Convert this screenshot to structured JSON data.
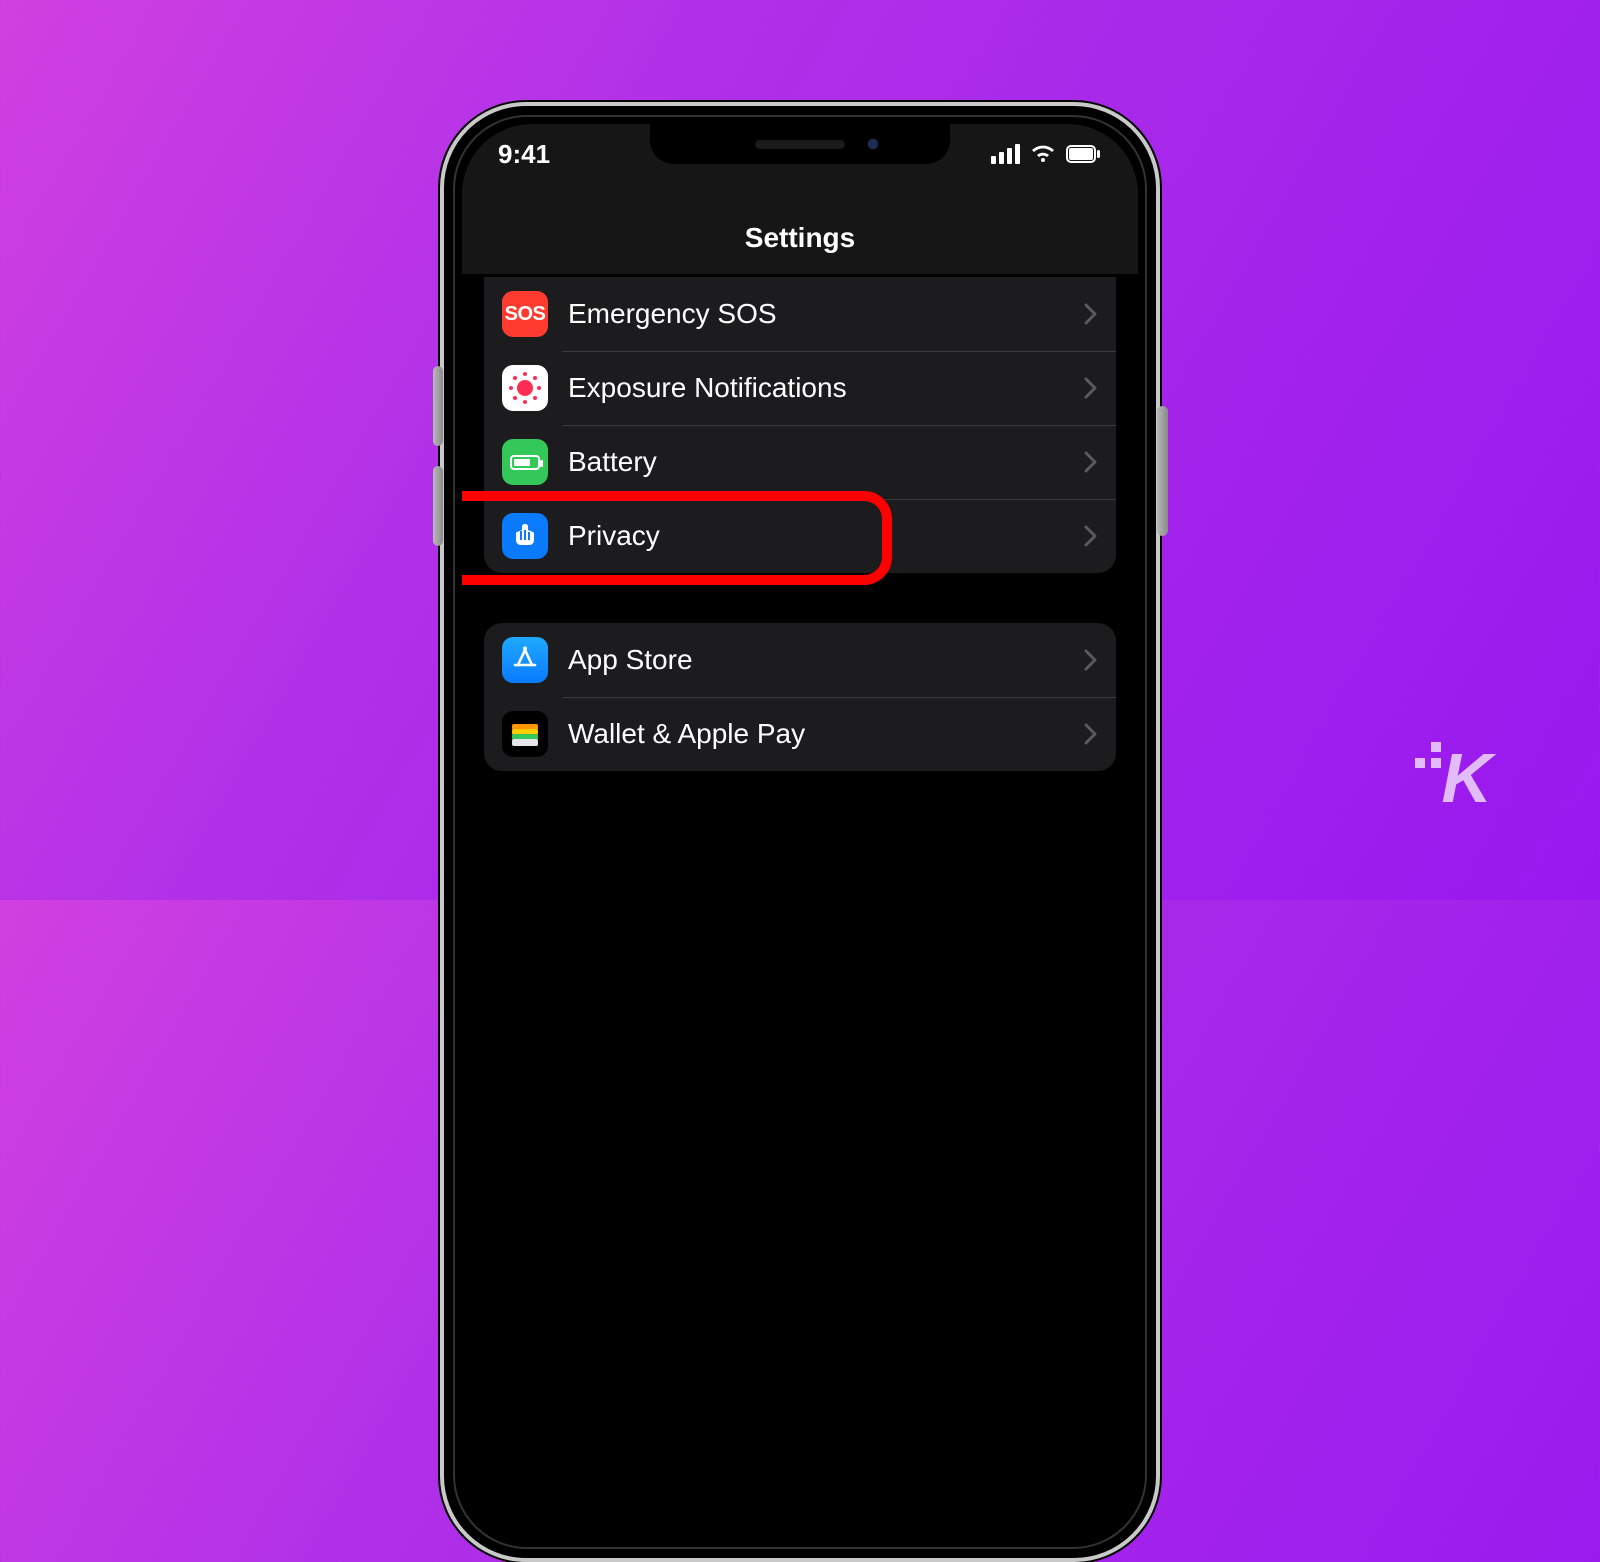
{
  "status": {
    "time": "9:41"
  },
  "header": {
    "title": "Settings"
  },
  "groups": [
    {
      "rows": [
        {
          "icon": "sos-icon",
          "label": "Emergency SOS"
        },
        {
          "icon": "exposure-icon",
          "label": "Exposure Notifications"
        },
        {
          "icon": "battery-icon",
          "label": "Battery"
        },
        {
          "icon": "privacy-icon",
          "label": "Privacy",
          "highlighted": true
        }
      ]
    },
    {
      "rows": [
        {
          "icon": "appstore-icon",
          "label": "App Store"
        },
        {
          "icon": "wallet-icon",
          "label": "Wallet & Apple Pay"
        }
      ]
    }
  ],
  "watermark": {
    "text": "K"
  },
  "colors": {
    "highlight": "#ff0000",
    "row_bg": "#1c1c1e",
    "accent_blue": "#0a7aff"
  },
  "icon_text": {
    "sos": "SOS"
  }
}
